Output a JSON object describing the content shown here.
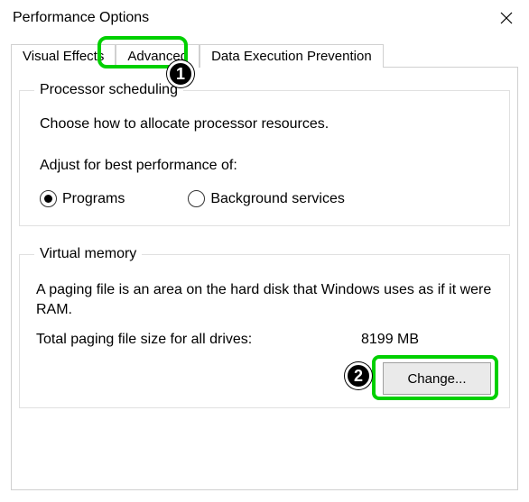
{
  "window": {
    "title": "Performance Options"
  },
  "tabs": {
    "visual_effects": "Visual Effects",
    "advanced": "Advanced",
    "dep": "Data Execution Prevention",
    "active": "advanced"
  },
  "callouts": {
    "one": "1",
    "two": "2"
  },
  "processor": {
    "legend": "Processor scheduling",
    "desc": "Choose how to allocate processor resources.",
    "adjust_label": "Adjust for best performance of:",
    "option_programs": "Programs",
    "option_background": "Background services",
    "selected": "programs"
  },
  "virtual_memory": {
    "legend": "Virtual memory",
    "desc": "A paging file is an area on the hard disk that Windows uses as if it were RAM.",
    "total_label": "Total paging file size for all drives:",
    "total_value": "8199 MB",
    "change_button": "Change..."
  }
}
